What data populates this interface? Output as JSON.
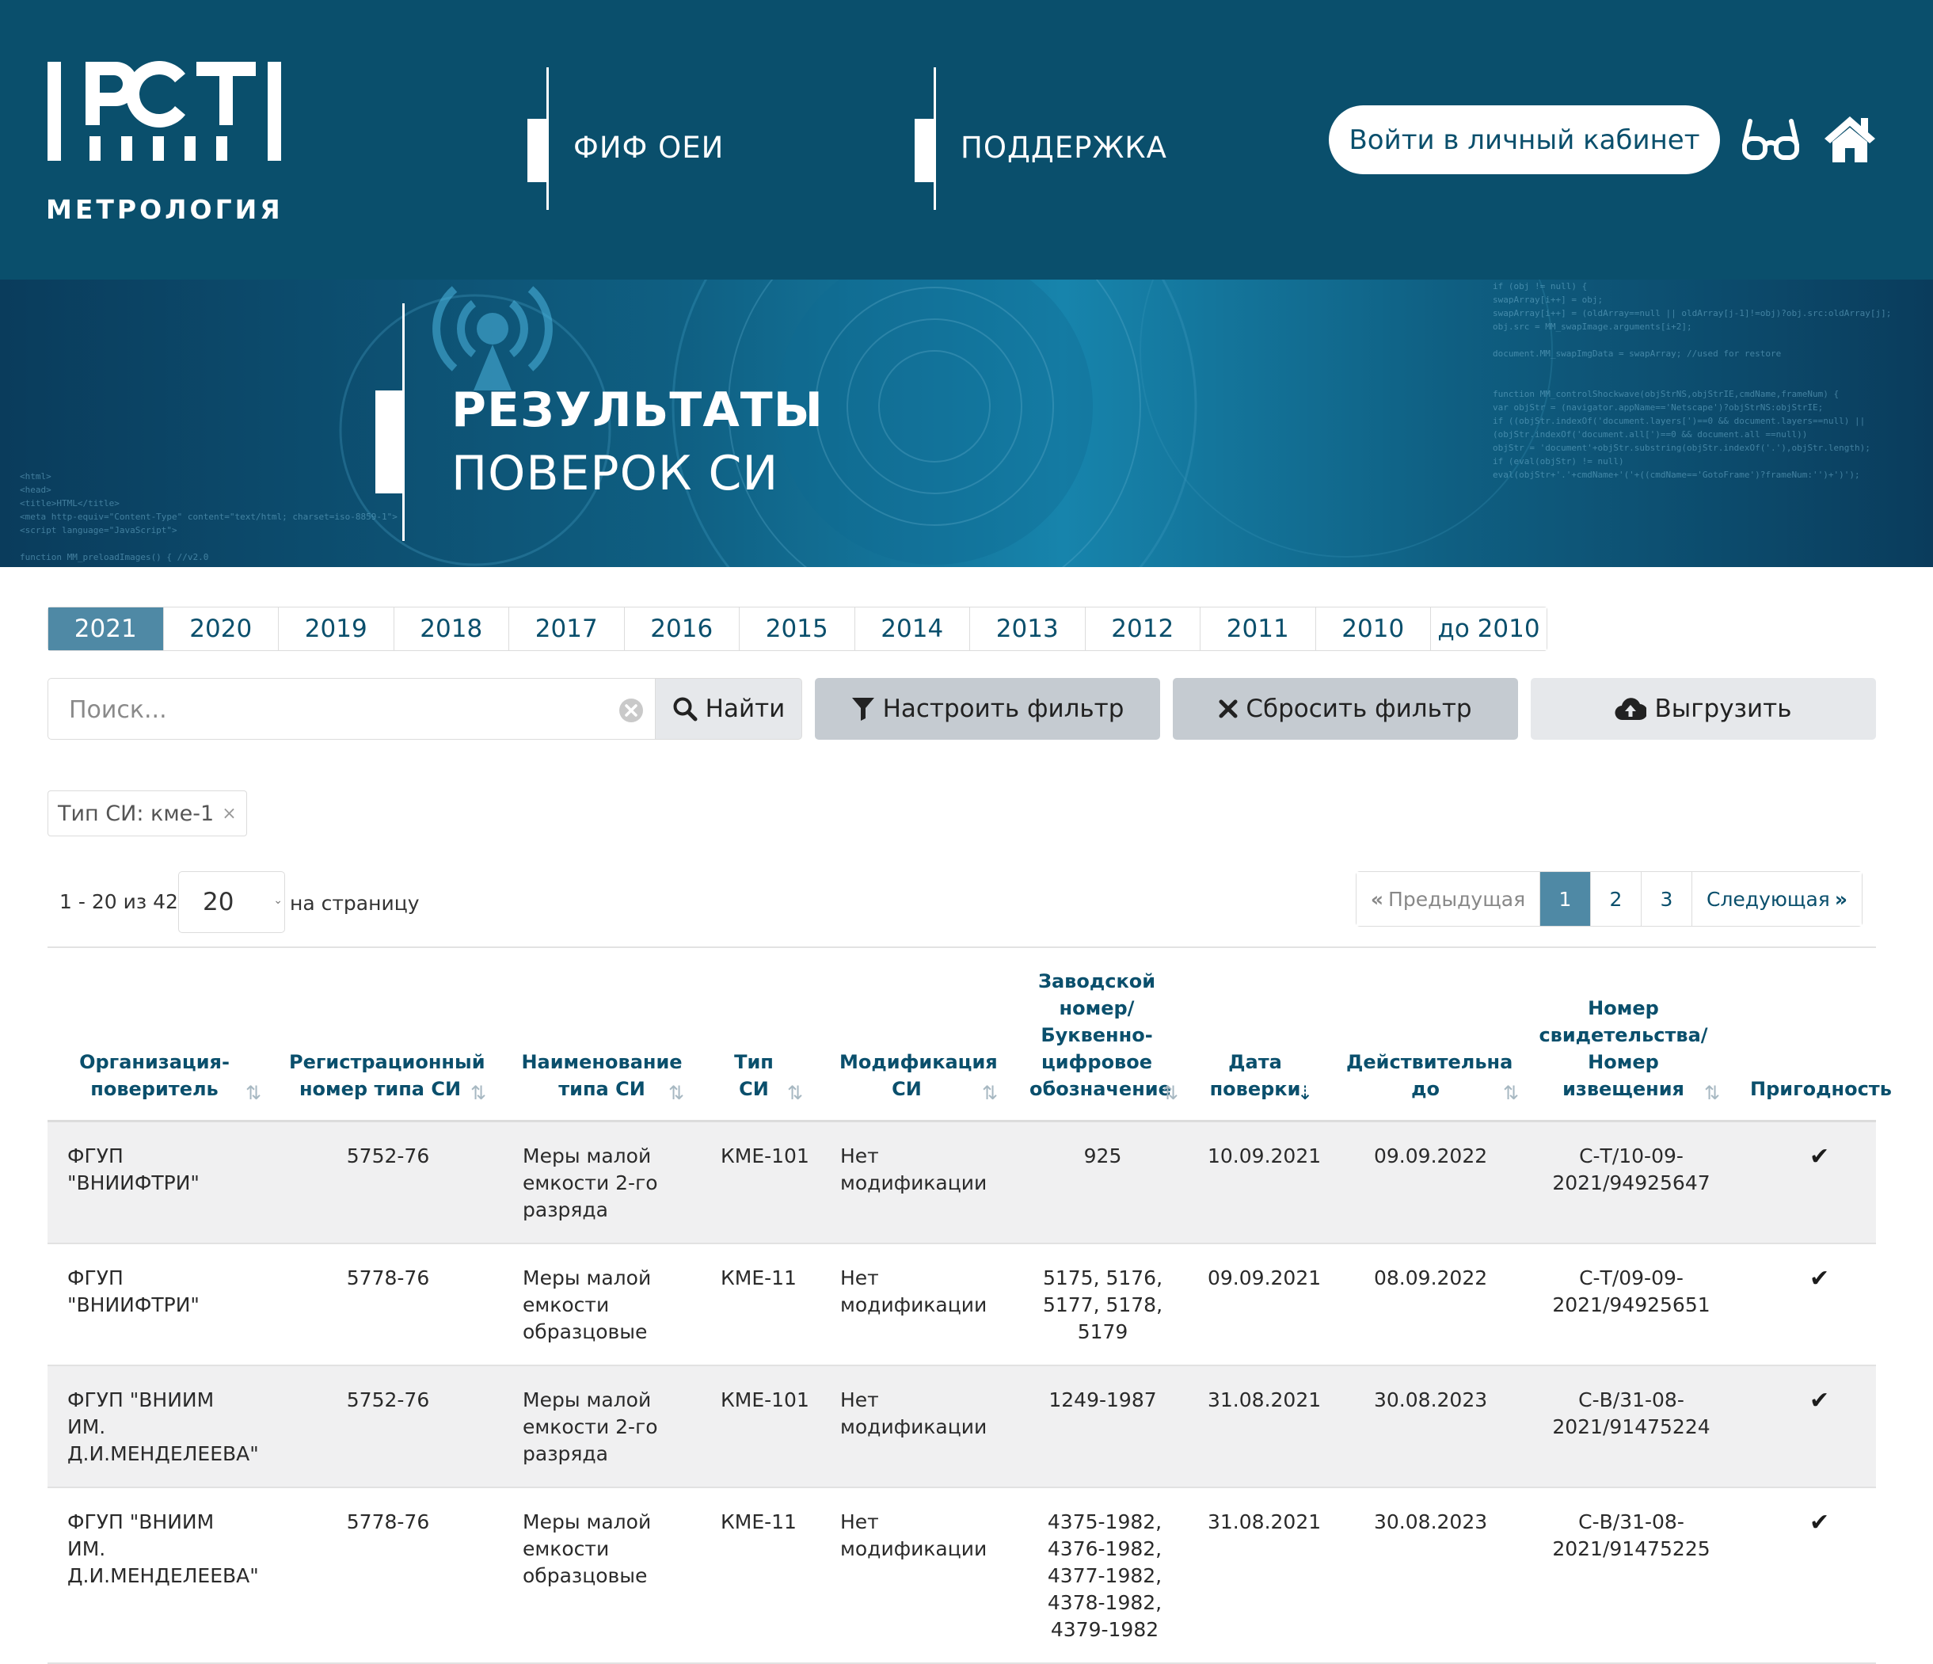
{
  "header": {
    "logo_text": "РСТ",
    "logo_sub": "МЕТРОЛОГИЯ",
    "nav": [
      {
        "label": "ФИФ ОЕИ"
      },
      {
        "label": "ПОДДЕРЖКА"
      }
    ],
    "login_label": "Войти в личный кабинет",
    "glasses_icon": "glasses-icon",
    "home_icon": "home-icon"
  },
  "banner": {
    "title_bold": "РЕЗУЛЬТАТЫ",
    "title_light": "ПОВЕРОК СИ"
  },
  "years": [
    {
      "label": "2021",
      "active": true
    },
    {
      "label": "2020"
    },
    {
      "label": "2019"
    },
    {
      "label": "2018"
    },
    {
      "label": "2017"
    },
    {
      "label": "2016"
    },
    {
      "label": "2015"
    },
    {
      "label": "2014"
    },
    {
      "label": "2013"
    },
    {
      "label": "2012"
    },
    {
      "label": "2011"
    },
    {
      "label": "2010"
    },
    {
      "label": "до 2010"
    }
  ],
  "search": {
    "placeholder": "Поиск...",
    "value": "",
    "find_label": "Найти",
    "filter_label": "Настроить фильтр",
    "reset_label": "Сбросить фильтр",
    "export_label": "Выгрузить"
  },
  "filter_chip": {
    "label": "Тип СИ: кме-1",
    "remove": "×"
  },
  "pagination": {
    "range": "1 - 20 из 42",
    "per_page": "20",
    "per_page_label": "на страницу",
    "prev_label": "Предыдущая",
    "pages": [
      "1",
      "2",
      "3"
    ],
    "active_page": "1",
    "next_label": "Следующая"
  },
  "table": {
    "columns": [
      {
        "label": "Организация-поверитель"
      },
      {
        "label": "Регистрационный номер типа СИ"
      },
      {
        "label": "Наименование типа СИ"
      },
      {
        "label": "Тип СИ"
      },
      {
        "label": "Модификация СИ"
      },
      {
        "label": "Заводской номер/ Буквенно-цифровое обозначение"
      },
      {
        "label": "Дата поверки"
      },
      {
        "label": "Действительна до"
      },
      {
        "label": "Номер свидетельства/ Номер извещения"
      },
      {
        "label": "Пригодность"
      }
    ],
    "rows": [
      {
        "org": "ФГУП \"ВНИИФТРИ\"",
        "reg": "5752-76",
        "name": "Меры малой емкости 2-го разряда",
        "type": "КМЕ-101",
        "mod": "Нет модификации",
        "serial": "925",
        "date": "10.09.2021",
        "valid": "09.09.2022",
        "cert": "С-Т/10-09-2021/94925647",
        "fit": "✔"
      },
      {
        "org": "ФГУП \"ВНИИФТРИ\"",
        "reg": "5778-76",
        "name": "Меры малой емкости образцовые",
        "type": "КМЕ-11",
        "mod": "Нет модификации",
        "serial": "5175, 5176, 5177, 5178, 5179",
        "date": "09.09.2021",
        "valid": "08.09.2022",
        "cert": "С-Т/09-09-2021/94925651",
        "fit": "✔"
      },
      {
        "org": "ФГУП \"ВНИИМ ИМ. Д.И.МЕНДЕЛЕЕВА\"",
        "reg": "5752-76",
        "name": "Меры малой емкости 2-го разряда",
        "type": "КМЕ-101",
        "mod": "Нет модификации",
        "serial": "1249-1987",
        "date": "31.08.2021",
        "valid": "30.08.2023",
        "cert": "С-В/31-08-2021/91475224",
        "fit": "✔"
      },
      {
        "org": "ФГУП \"ВНИИМ ИМ. Д.И.МЕНДЕЛЕЕВА\"",
        "reg": "5778-76",
        "name": "Меры малой емкости образцовые",
        "type": "КМЕ-11",
        "mod": "Нет модификации",
        "serial": "4375-1982, 4376-1982, 4377-1982, 4378-1982, 4379-1982",
        "date": "31.08.2021",
        "valid": "30.08.2023",
        "cert": "С-В/31-08-2021/91475225",
        "fit": "✔"
      }
    ]
  },
  "colors": {
    "header_bg": "#0a4f6c",
    "accent": "#4f89a5",
    "button_gray": "#c5cbd1",
    "row_stripe": "#f0f0f1"
  }
}
